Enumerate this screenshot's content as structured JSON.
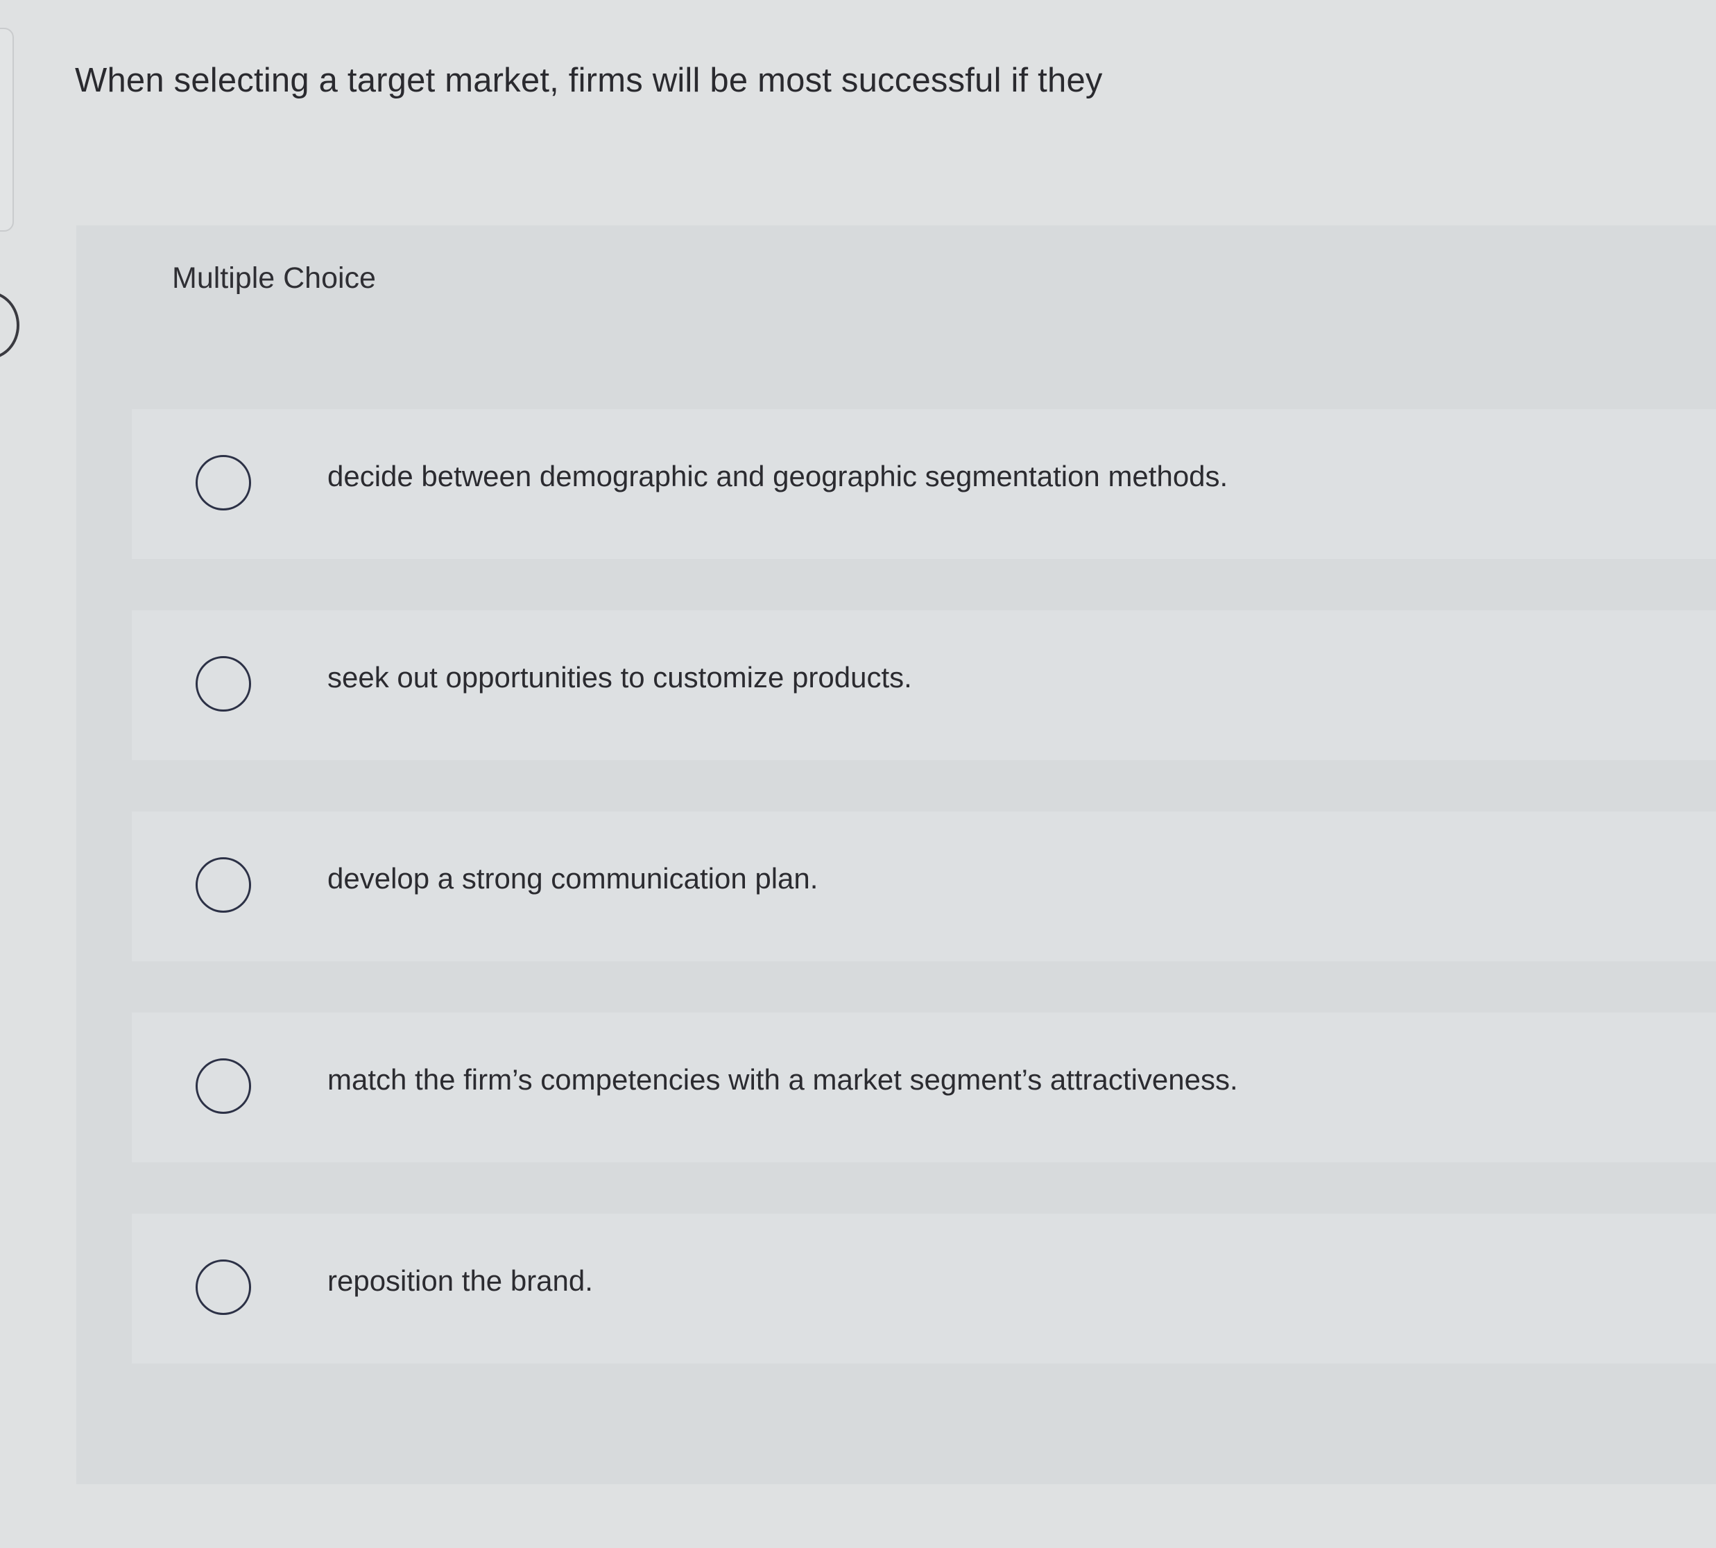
{
  "question": {
    "text": "When selecting a target market, firms will be most successful if they"
  },
  "answer_panel": {
    "type_label": "Multiple Choice",
    "options": [
      {
        "label": "decide between demographic and geographic segmentation methods.",
        "selected": false
      },
      {
        "label": "seek out opportunities to customize products.",
        "selected": false
      },
      {
        "label": "develop a strong communication plan.",
        "selected": false
      },
      {
        "label": "match the firm’s competencies with a market segment’s attractiveness.",
        "selected": false
      },
      {
        "label": "reposition the brand.",
        "selected": false
      }
    ]
  },
  "colors": {
    "page_background": "#dfe1e2",
    "panel_background": "#d7dadc",
    "option_background": "#dde0e2",
    "radio_border": "#2c3146",
    "text": "#2b2b30"
  },
  "icons": {
    "radio": "radio-unselected-icon"
  }
}
